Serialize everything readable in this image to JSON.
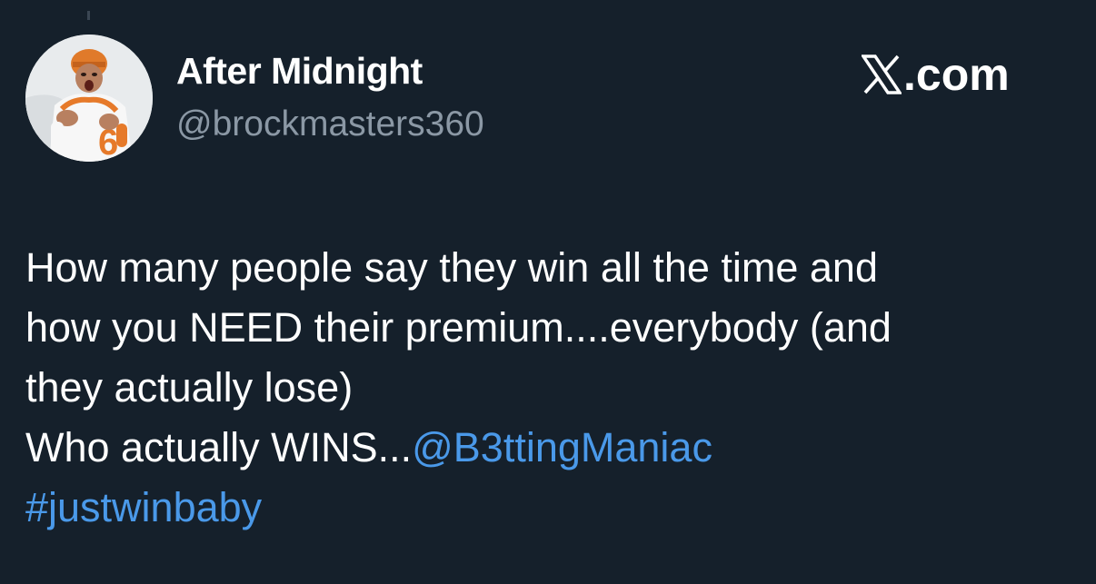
{
  "account": {
    "display_name": "After Midnight",
    "handle": "@brockmasters360",
    "avatar_icon": "football-player-avatar"
  },
  "brand": {
    "text": ".com",
    "icon": "x-logo-icon"
  },
  "tweet": {
    "lines": [
      "How many people say they win all the time and",
      "how you NEED their premium....everybody (and",
      "they actually lose)"
    ],
    "line4_text": "Who actually WINS...",
    "mention": "@B3ttingManiac",
    "hashtag": "#justwinbaby"
  },
  "colors": {
    "background": "#15202b",
    "text": "#ffffff",
    "secondary_text": "#8b98a5",
    "link": "#4a99e9"
  }
}
